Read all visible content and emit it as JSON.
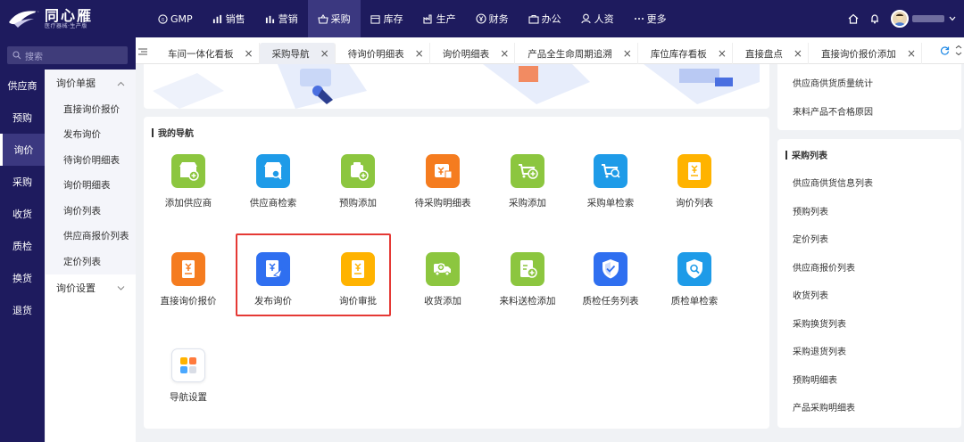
{
  "brand": {
    "title": "同心雁",
    "subtitle": "医疗器械·生产版"
  },
  "topnav": [
    {
      "label": "GMP",
      "icon": "gmp-icon"
    },
    {
      "label": "销售",
      "icon": "bar-chart-icon"
    },
    {
      "label": "营销",
      "icon": "bar-chart-icon"
    },
    {
      "label": "采购",
      "icon": "basket-icon",
      "active": true
    },
    {
      "label": "库存",
      "icon": "warehouse-icon"
    },
    {
      "label": "生产",
      "icon": "factory-icon"
    },
    {
      "label": "财务",
      "icon": "yen-coin-icon"
    },
    {
      "label": "办公",
      "icon": "briefcase-icon"
    },
    {
      "label": "人资",
      "icon": "user-icon"
    },
    {
      "label": "更多",
      "icon": "more-icon"
    }
  ],
  "search": {
    "placeholder": "搜索"
  },
  "leftnav": [
    "供应商",
    "预购",
    "询价",
    "采购",
    "收货",
    "质检",
    "换货",
    "退货"
  ],
  "leftnav_active": "询价",
  "subnav": {
    "group1": {
      "label": "询价单据",
      "items": [
        "直接询价报价",
        "发布询价",
        "待询价明细表",
        "询价明细表",
        "询价列表",
        "供应商报价列表",
        "定价列表"
      ]
    },
    "group2": {
      "label": "询价设置"
    }
  },
  "tabs": [
    {
      "label": "车间一体化看板"
    },
    {
      "label": "采购导航",
      "active": true
    },
    {
      "label": "待询价明细表"
    },
    {
      "label": "询价明细表"
    },
    {
      "label": "产品全生命周期追溯"
    },
    {
      "label": "库位库存看板"
    },
    {
      "label": "直接盘点"
    },
    {
      "label": "直接询价报价添加"
    }
  ],
  "tab_close": "×",
  "my_nav": {
    "title": "我的导航",
    "items": [
      {
        "label": "添加供应商",
        "icon": "add-supplier-icon",
        "color": "#8cc63f"
      },
      {
        "label": "供应商检索",
        "icon": "supplier-search-icon",
        "color": "#1e9be8"
      },
      {
        "label": "预购添加",
        "icon": "pre-order-add-icon",
        "color": "#8cc63f"
      },
      {
        "label": "待采购明细表",
        "icon": "pending-purchase-icon",
        "color": "#f57c1f"
      },
      {
        "label": "采购添加",
        "icon": "purchase-add-icon",
        "color": "#8cc63f"
      },
      {
        "label": "采购单检索",
        "icon": "cart-search-icon",
        "color": "#1e9be8"
      },
      {
        "label": "询价列表",
        "icon": "yen-document-icon",
        "color": "#ffb300"
      },
      {
        "label": "直接询价报价",
        "icon": "yen-document-icon",
        "color": "#f57c1f"
      },
      {
        "label": "发布询价",
        "icon": "publish-inquiry-icon",
        "color": "#2f6ff0"
      },
      {
        "label": "询价审批",
        "icon": "yen-document-icon",
        "color": "#ffb300"
      },
      {
        "label": "收货添加",
        "icon": "truck-add-icon",
        "color": "#8cc63f"
      },
      {
        "label": "来料送检添加",
        "icon": "inspection-add-icon",
        "color": "#8cc63f"
      },
      {
        "label": "质检任务列表",
        "icon": "shield-check-icon",
        "color": "#2f6ff0"
      },
      {
        "label": "质检单检索",
        "icon": "shield-search-icon",
        "color": "#1e9be8"
      },
      {
        "label": "导航设置",
        "icon": "nav-settings-icon",
        "color": "#ffffff"
      }
    ]
  },
  "right_top_links": [
    "供应商供货质量统计",
    "来料产品不合格原因"
  ],
  "purchase_lists": {
    "title": "采购列表",
    "items": [
      "供应商供货信息列表",
      "预购列表",
      "定价列表",
      "供应商报价列表",
      "收货列表",
      "采购换货列表",
      "采购退货列表",
      "预购明细表",
      "产品采购明细表"
    ]
  }
}
